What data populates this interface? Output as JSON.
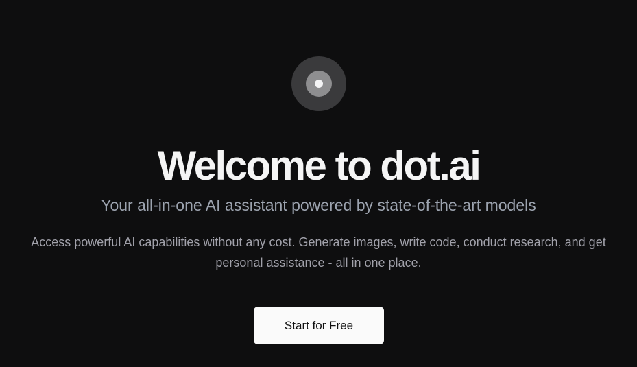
{
  "logo": {
    "icon": "dot-logo-icon",
    "colors": {
      "outer": "#3a3a3c",
      "ring": "#8e8e90",
      "dot": "#f4f4f5"
    }
  },
  "hero": {
    "title": "Welcome to dot.ai",
    "subtitle": "Your all-in-one AI assistant powered by state-of-the-art models",
    "description": "Access powerful AI capabilities without any cost. Generate images, write code, conduct research, and get personal assistance - all in one place.",
    "cta_label": "Start for Free"
  },
  "theme": {
    "background": "#0e0e0f",
    "title_color": "#f5f5f5",
    "subtitle_color": "#9ca3af",
    "button_bg": "#fafafa"
  }
}
